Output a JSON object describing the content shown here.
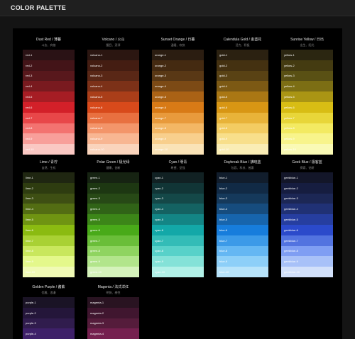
{
  "app": {
    "title": "COLOR PALETTE"
  },
  "palettes": [
    {
      "name": "Dust Red / 薄暮",
      "desc": "斗志、奔放",
      "colors": [
        {
          "label": "red-1",
          "hex": "#2a1215",
          "fg": "#ffffff"
        },
        {
          "label": "red-2",
          "hex": "#431418",
          "fg": "#ffffff"
        },
        {
          "label": "red-3",
          "hex": "#58181c",
          "fg": "#ffffff"
        },
        {
          "label": "red-4",
          "hex": "#791a1f",
          "fg": "#ffffff"
        },
        {
          "label": "red-5",
          "hex": "#a61d24",
          "fg": "#ffffff"
        },
        {
          "label": "red-6",
          "hex": "#d32029",
          "fg": "#ffffff"
        },
        {
          "label": "red-7",
          "hex": "#e84749",
          "fg": "#ffffff"
        },
        {
          "label": "red-8",
          "hex": "#f37370",
          "fg": "#ffffff"
        },
        {
          "label": "red-9",
          "hex": "#f89f9a",
          "fg": "#ffffff"
        },
        {
          "label": "red-10",
          "hex": "#fac8c3",
          "fg": "#ffffff"
        }
      ]
    },
    {
      "name": "Volcano / 火山",
      "desc": "醒目、澎湃",
      "colors": [
        {
          "label": "volcano-1",
          "hex": "#2b1611",
          "fg": "#ffffff"
        },
        {
          "label": "volcano-2",
          "hex": "#441d12",
          "fg": "#ffffff"
        },
        {
          "label": "volcano-3",
          "hex": "#592716",
          "fg": "#ffffff"
        },
        {
          "label": "volcano-4",
          "hex": "#7c3118",
          "fg": "#ffffff"
        },
        {
          "label": "volcano-5",
          "hex": "#aa3e19",
          "fg": "#ffffff"
        },
        {
          "label": "volcano-6",
          "hex": "#d84a1b",
          "fg": "#ffffff"
        },
        {
          "label": "volcano-7",
          "hex": "#e87040",
          "fg": "#ffffff"
        },
        {
          "label": "volcano-8",
          "hex": "#f3956a",
          "fg": "#ffffff"
        },
        {
          "label": "volcano-9",
          "hex": "#f8b692",
          "fg": "#ffffff"
        },
        {
          "label": "volcano-10",
          "hex": "#fad4bc",
          "fg": "#ffffff"
        }
      ]
    },
    {
      "name": "Sunset Orange / 日暮",
      "desc": "温暖、欢快",
      "colors": [
        {
          "label": "orange-1",
          "hex": "#2b1d11",
          "fg": "#ffffff"
        },
        {
          "label": "orange-2",
          "hex": "#442a11",
          "fg": "#ffffff"
        },
        {
          "label": "orange-3",
          "hex": "#593815",
          "fg": "#ffffff"
        },
        {
          "label": "orange-4",
          "hex": "#7c4a15",
          "fg": "#ffffff"
        },
        {
          "label": "orange-5",
          "hex": "#aa6215",
          "fg": "#ffffff"
        },
        {
          "label": "orange-6",
          "hex": "#d87a16",
          "fg": "#ffffff"
        },
        {
          "label": "orange-7",
          "hex": "#e89a3c",
          "fg": "#ffffff"
        },
        {
          "label": "orange-8",
          "hex": "#f3b765",
          "fg": "#ffffff"
        },
        {
          "label": "orange-9",
          "hex": "#f8cf8d",
          "fg": "#ffffff"
        },
        {
          "label": "orange-10",
          "hex": "#fae3b7",
          "fg": "#ffffff"
        }
      ]
    },
    {
      "name": "Calendula Gold / 金盏花",
      "desc": "活力、积极",
      "colors": [
        {
          "label": "gold-1",
          "hex": "#2b2111",
          "fg": "#ffffff"
        },
        {
          "label": "gold-2",
          "hex": "#443111",
          "fg": "#ffffff"
        },
        {
          "label": "gold-3",
          "hex": "#594214",
          "fg": "#ffffff"
        },
        {
          "label": "gold-4",
          "hex": "#7c5914",
          "fg": "#ffffff"
        },
        {
          "label": "gold-5",
          "hex": "#aa7714",
          "fg": "#ffffff"
        },
        {
          "label": "gold-6",
          "hex": "#d89614",
          "fg": "#ffffff"
        },
        {
          "label": "gold-7",
          "hex": "#e8b339",
          "fg": "#ffffff"
        },
        {
          "label": "gold-8",
          "hex": "#f3cc62",
          "fg": "#ffffff"
        },
        {
          "label": "gold-9",
          "hex": "#f8df8b",
          "fg": "#ffffff"
        },
        {
          "label": "gold-10",
          "hex": "#faedb5",
          "fg": "#ffffff"
        }
      ]
    },
    {
      "name": "Sunrise Yellow / 日出",
      "desc": "出生、阳光",
      "colors": [
        {
          "label": "yellow-1",
          "hex": "#2b2611",
          "fg": "#ffffff"
        },
        {
          "label": "yellow-2",
          "hex": "#443b11",
          "fg": "#ffffff"
        },
        {
          "label": "yellow-3",
          "hex": "#595014",
          "fg": "#ffffff"
        },
        {
          "label": "yellow-4",
          "hex": "#7c6e14",
          "fg": "#ffffff"
        },
        {
          "label": "yellow-5",
          "hex": "#aa9514",
          "fg": "#ffffff"
        },
        {
          "label": "yellow-6",
          "hex": "#d8bd14",
          "fg": "#ffffff"
        },
        {
          "label": "yellow-7",
          "hex": "#e8d639",
          "fg": "#ffffff"
        },
        {
          "label": "yellow-8",
          "hex": "#f3ea62",
          "fg": "#ffffff"
        },
        {
          "label": "yellow-9",
          "hex": "#f8f48b",
          "fg": "#ffffff"
        },
        {
          "label": "yellow-10",
          "hex": "#fafab5",
          "fg": "#ffffff"
        }
      ]
    },
    {
      "name": "Lime / 青柠",
      "desc": "自然、生机",
      "colors": [
        {
          "label": "lime-1",
          "hex": "#1f2611",
          "fg": "#ffffff"
        },
        {
          "label": "lime-2",
          "hex": "#2e3c10",
          "fg": "#ffffff"
        },
        {
          "label": "lime-3",
          "hex": "#3e4f13",
          "fg": "#ffffff"
        },
        {
          "label": "lime-4",
          "hex": "#536d13",
          "fg": "#ffffff"
        },
        {
          "label": "lime-5",
          "hex": "#6f9412",
          "fg": "#ffffff"
        },
        {
          "label": "lime-6",
          "hex": "#8bbb11",
          "fg": "#ffffff"
        },
        {
          "label": "lime-7",
          "hex": "#a9d134",
          "fg": "#ffffff"
        },
        {
          "label": "lime-8",
          "hex": "#c9e75d",
          "fg": "#ffffff"
        },
        {
          "label": "lime-9",
          "hex": "#e4f88b",
          "fg": "#ffffff"
        },
        {
          "label": "lime-10",
          "hex": "#f0fab5",
          "fg": "#ffffff"
        }
      ]
    },
    {
      "name": "Polar Green / 极光绿",
      "desc": "健康、创新",
      "colors": [
        {
          "label": "green-1",
          "hex": "#162312",
          "fg": "#ffffff"
        },
        {
          "label": "green-2",
          "hex": "#1d3712",
          "fg": "#ffffff"
        },
        {
          "label": "green-3",
          "hex": "#274916",
          "fg": "#ffffff"
        },
        {
          "label": "green-4",
          "hex": "#306317",
          "fg": "#ffffff"
        },
        {
          "label": "green-5",
          "hex": "#3c8618",
          "fg": "#ffffff"
        },
        {
          "label": "green-6",
          "hex": "#49aa19",
          "fg": "#ffffff"
        },
        {
          "label": "green-7",
          "hex": "#6abe39",
          "fg": "#ffffff"
        },
        {
          "label": "green-8",
          "hex": "#8fd460",
          "fg": "#ffffff"
        },
        {
          "label": "green-9",
          "hex": "#b2e58b",
          "fg": "#ffffff"
        },
        {
          "label": "green-10",
          "hex": "#d5f2bb",
          "fg": "#ffffff"
        }
      ]
    },
    {
      "name": "Cyan / 明青",
      "desc": "希望、坚强",
      "colors": [
        {
          "label": "cyan-1",
          "hex": "#112123",
          "fg": "#ffffff"
        },
        {
          "label": "cyan-2",
          "hex": "#113536",
          "fg": "#ffffff"
        },
        {
          "label": "cyan-3",
          "hex": "#144848",
          "fg": "#ffffff"
        },
        {
          "label": "cyan-4",
          "hex": "#146262",
          "fg": "#ffffff"
        },
        {
          "label": "cyan-5",
          "hex": "#138585",
          "fg": "#ffffff"
        },
        {
          "label": "cyan-6",
          "hex": "#13a8a8",
          "fg": "#ffffff"
        },
        {
          "label": "cyan-7",
          "hex": "#33bcb7",
          "fg": "#ffffff"
        },
        {
          "label": "cyan-8",
          "hex": "#58d1c9",
          "fg": "#ffffff"
        },
        {
          "label": "cyan-9",
          "hex": "#84e2d8",
          "fg": "#ffffff"
        },
        {
          "label": "cyan-10",
          "hex": "#b2f1e8",
          "fg": "#ffffff"
        }
      ]
    },
    {
      "name": "Daybreak Blue / 拂晓蓝",
      "desc": "包容、科技、普惠",
      "colors": [
        {
          "label": "blue-1",
          "hex": "#111d2c",
          "fg": "#ffffff"
        },
        {
          "label": "blue-2",
          "hex": "#112a45",
          "fg": "#ffffff"
        },
        {
          "label": "blue-3",
          "hex": "#15395b",
          "fg": "#ffffff"
        },
        {
          "label": "blue-4",
          "hex": "#164c7e",
          "fg": "#ffffff"
        },
        {
          "label": "blue-5",
          "hex": "#1765ad",
          "fg": "#ffffff"
        },
        {
          "label": "blue-6",
          "hex": "#177ddc",
          "fg": "#ffffff"
        },
        {
          "label": "blue-7",
          "hex": "#3c9ae8",
          "fg": "#ffffff"
        },
        {
          "label": "blue-8",
          "hex": "#65b7f3",
          "fg": "#ffffff"
        },
        {
          "label": "blue-9",
          "hex": "#8dcff8",
          "fg": "#ffffff"
        },
        {
          "label": "blue-10",
          "hex": "#b7e3fa",
          "fg": "#ffffff"
        }
      ]
    },
    {
      "name": "Geek Blue / 极客蓝",
      "desc": "探索、钻研",
      "colors": [
        {
          "label": "geekblue-1",
          "hex": "#131629",
          "fg": "#ffffff"
        },
        {
          "label": "geekblue-2",
          "hex": "#161d40",
          "fg": "#ffffff"
        },
        {
          "label": "geekblue-3",
          "hex": "#1c2755",
          "fg": "#ffffff"
        },
        {
          "label": "geekblue-4",
          "hex": "#203175",
          "fg": "#ffffff"
        },
        {
          "label": "geekblue-5",
          "hex": "#263ea0",
          "fg": "#ffffff"
        },
        {
          "label": "geekblue-6",
          "hex": "#2b4acb",
          "fg": "#ffffff"
        },
        {
          "label": "geekblue-7",
          "hex": "#5273e0",
          "fg": "#ffffff"
        },
        {
          "label": "geekblue-8",
          "hex": "#7f9ef3",
          "fg": "#ffffff"
        },
        {
          "label": "geekblue-9",
          "hex": "#a8c1f8",
          "fg": "#ffffff"
        },
        {
          "label": "geekblue-10",
          "hex": "#d2e0fa",
          "fg": "#ffffff"
        }
      ]
    },
    {
      "name": "Golden Purple / 酱紫",
      "desc": "优雅、浪漫",
      "colors": [
        {
          "label": "purple-1",
          "hex": "#1a1325",
          "fg": "#ffffff"
        },
        {
          "label": "purple-2",
          "hex": "#24163a",
          "fg": "#ffffff"
        },
        {
          "label": "purple-3",
          "hex": "#301c4d",
          "fg": "#ffffff"
        },
        {
          "label": "purple-4",
          "hex": "#3e2069",
          "fg": "#ffffff"
        }
      ]
    },
    {
      "name": "Magenta / 法式洋红",
      "desc": "明快、感性",
      "colors": [
        {
          "label": "magenta-1",
          "hex": "#291321",
          "fg": "#ffffff"
        },
        {
          "label": "magenta-2",
          "hex": "#40162f",
          "fg": "#ffffff"
        },
        {
          "label": "magenta-3",
          "hex": "#551c3b",
          "fg": "#ffffff"
        },
        {
          "label": "magenta-4",
          "hex": "#75204f",
          "fg": "#ffffff"
        }
      ]
    }
  ]
}
